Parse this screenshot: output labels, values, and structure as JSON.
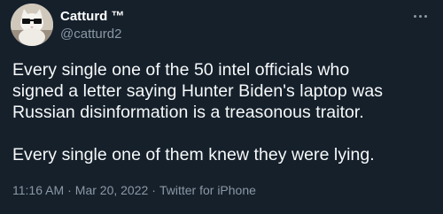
{
  "author": {
    "display_name": "Catturd ™",
    "handle": "@catturd2"
  },
  "tweet": {
    "lines": [
      "Every single one of the 50 intel officials who",
      "signed a letter saying Hunter Biden's laptop was",
      "Russian disinformation is a treasonous traitor.",
      "Every single one of them knew they were lying."
    ]
  },
  "meta": {
    "time": "11:16 AM",
    "date": "Mar 20, 2022",
    "source": "Twitter for iPhone",
    "separator": "·"
  },
  "icons": {
    "more": "more-horizontal-icon",
    "avatar": "cat-avatar"
  },
  "colors": {
    "background": "#15202b",
    "text_primary": "#f7f9f9",
    "text_secondary": "#8b98a5"
  }
}
